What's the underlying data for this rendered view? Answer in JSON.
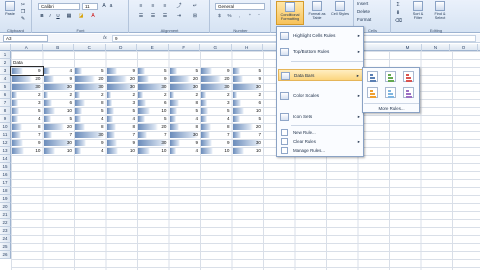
{
  "ribbon": {
    "clipboard": {
      "label": "Clipboard",
      "paste": "Paste"
    },
    "font": {
      "label": "Font",
      "name": "Calibri",
      "size": "11",
      "bold": "B",
      "italic": "I",
      "underline": "U"
    },
    "alignment": {
      "label": "Alignment"
    },
    "number": {
      "label": "Number",
      "format": "General",
      "currency": "$",
      "percent": "%",
      "comma": ","
    },
    "styles": {
      "label": "Styles",
      "cond_format": "Conditional Formatting",
      "format_table": "Format as Table",
      "cell_styles": "Cell Styles"
    },
    "cells": {
      "label": "Cells",
      "insert": "Insert",
      "delete": "Delete",
      "format": "Format"
    },
    "editing": {
      "label": "Editing",
      "sigma": "Σ",
      "sort": "Sort & Filter",
      "find": "Find & Select"
    }
  },
  "formula_bar": {
    "name_box": "A3",
    "fx": "fx",
    "value": "9"
  },
  "columns": [
    "A",
    "B",
    "C",
    "D",
    "E",
    "F",
    "G",
    "H",
    "I"
  ],
  "extra_columns": [
    "M",
    "N",
    "O"
  ],
  "rows": [
    "1",
    "2",
    "3",
    "4",
    "5",
    "6",
    "7",
    "8",
    "9",
    "10",
    "11",
    "12",
    "13",
    "14",
    "15",
    "16",
    "17",
    "18",
    "19",
    "20",
    "21",
    "22",
    "23",
    "24",
    "25",
    "26"
  ],
  "header_cell": "Data",
  "table": [
    [
      9,
      4,
      5,
      9,
      5,
      5,
      9,
      5
    ],
    [
      20,
      9,
      20,
      20,
      9,
      20,
      20,
      9
    ],
    [
      30,
      30,
      30,
      30,
      30,
      30,
      30,
      30
    ],
    [
      2,
      2,
      2,
      2,
      2,
      2,
      2,
      2
    ],
    [
      3,
      6,
      8,
      3,
      6,
      8,
      3,
      6
    ],
    [
      5,
      10,
      5,
      5,
      10,
      5,
      5,
      10
    ],
    [
      4,
      5,
      4,
      4,
      5,
      4,
      4,
      5
    ],
    [
      8,
      20,
      8,
      8,
      20,
      8,
      8,
      20
    ],
    [
      7,
      7,
      30,
      7,
      7,
      30,
      7,
      7
    ],
    [
      9,
      30,
      9,
      9,
      30,
      9,
      9,
      30
    ],
    [
      10,
      10,
      4,
      10,
      10,
      4,
      10,
      10
    ]
  ],
  "cf_menu": {
    "highlight": "Highlight Cells Rules",
    "topbottom": "Top/Bottom Rules",
    "databars": "Data Bars",
    "colorscales": "Color Scales",
    "iconsets": "Icon Sets",
    "newrule": "New Rule...",
    "clearrules": "Clear Rules",
    "managerules": "Manage Rules...",
    "arrow": "▸"
  },
  "databars_submenu": {
    "more": "More Rules..."
  },
  "colors": {
    "bar_blue": "#5a7fb3",
    "bar_green": "#63a84f",
    "bar_red": "#d9534f",
    "bar_orange": "#f0a030",
    "bar_light": "#7fb5e0",
    "bar_purple": "#9b6fc4"
  }
}
